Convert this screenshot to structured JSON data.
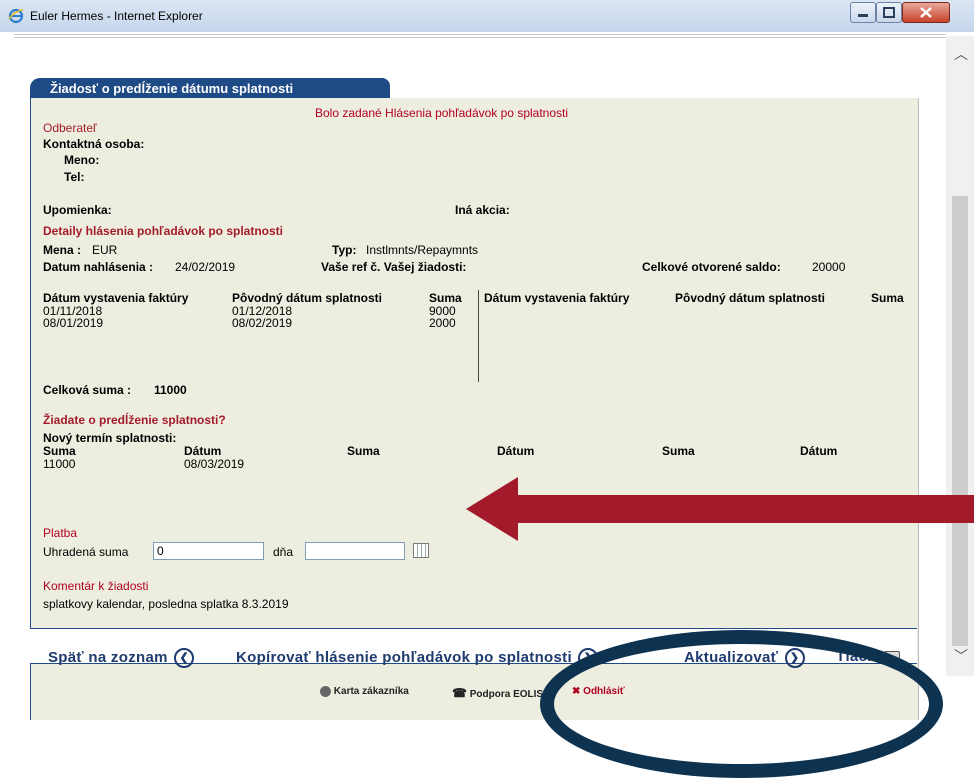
{
  "window": {
    "title": "Euler Hermes - Internet Explorer"
  },
  "tab": {
    "label": "Žiadosť o predĺženie dátumu splatnosti"
  },
  "notice": "Bolo zadané Hlásenia pohľadávok po splatnosti",
  "customer": {
    "heading": "Odberateľ",
    "contact_label": "Kontaktná osoba:",
    "name_label": "Meno:",
    "phone_label": "Tel:"
  },
  "reminder_label": "Upomienka:",
  "other_action_label": "Iná akcia:",
  "details": {
    "heading": "Detaily hlásenia pohľadávok po splatnosti",
    "currency_label": "Mena :",
    "currency_value": "EUR",
    "type_label": "Typ:",
    "type_value": "Instlmnts/Repaymnts",
    "report_date_label": "Datum nahlásenia :",
    "report_date_value": "24/02/2019",
    "ref_label": "Vaše ref č. Vašej žiadosti:",
    "balance_label": "Celkové otvorené saldo:",
    "balance_value": "20000"
  },
  "invoices": {
    "headers": [
      "Dátum vystavenia faktúry",
      "Pôvodný dátum splatnosti",
      "Suma"
    ],
    "rows": [
      {
        "issued": "01/11/2018",
        "due": "01/12/2018",
        "amount": "9000"
      },
      {
        "issued": "08/01/2019",
        "due": "08/02/2019",
        "amount": "2000"
      }
    ],
    "total_label": "Celková suma :",
    "total_value": "11000"
  },
  "extension": {
    "question": "Žiadate o predĺženie splatnosti?",
    "new_term_label": "Nový termín splatnosti:",
    "headers": [
      "Suma",
      "Dátum",
      "Suma",
      "Dátum",
      "Suma",
      "Dátum"
    ],
    "row": {
      "amount": "11000",
      "date": "08/03/2019"
    }
  },
  "payment": {
    "heading": "Platba",
    "paid_label": "Uhradená suma",
    "paid_value": "0",
    "date_label": "dňa",
    "date_value": ""
  },
  "comment": {
    "heading": "Komentár k žiadosti",
    "text": "splatkovy kalendar, posledna splatka 8.3.2019"
  },
  "nav": {
    "back": "Späť na zoznam",
    "copy": "Kopírovať hlásenie pohľadávok po splatnosti",
    "update": "Aktualizovať",
    "print": "Tlačiť"
  },
  "footer": {
    "card": "Karta zákazníka",
    "support": "Podpora EOLIS",
    "logout": "Odhlásiť"
  },
  "colors": {
    "accent": "#1e4a86",
    "highlight": "#a31b2b",
    "panel": "#eeeee0",
    "annotation_oval": "#0e3350"
  }
}
